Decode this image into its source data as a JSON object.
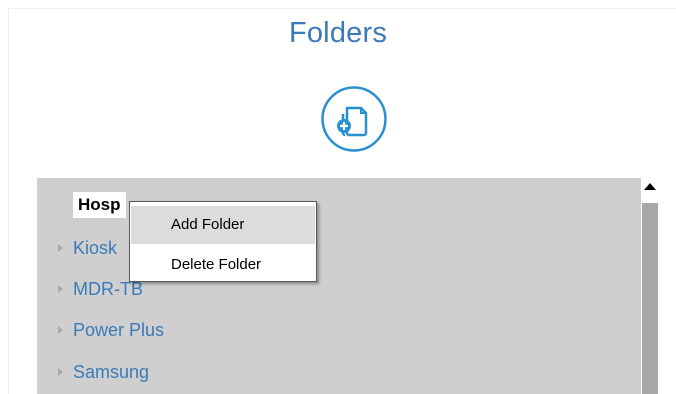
{
  "page": {
    "title": "Folders",
    "add_folder_icon": "folder-plus-icon"
  },
  "tree": {
    "root_label": "Hospital",
    "root_visible_text": "Hosp",
    "items": [
      {
        "label": "Kiosk",
        "icon": "collapsed-triangle-icon"
      },
      {
        "label": "MDR-TB",
        "icon": "collapsed-triangle-icon"
      },
      {
        "label": "Power Plus",
        "icon": "collapsed-triangle-icon"
      },
      {
        "label": "Samsung",
        "icon": "collapsed-triangle-icon"
      }
    ]
  },
  "context_menu": {
    "items": [
      {
        "label": "Add Folder",
        "highlighted": true
      },
      {
        "label": "Delete Folder",
        "highlighted": false
      }
    ]
  },
  "colors": {
    "accent": "#3a7ab8",
    "panel": "#cfcfcf",
    "menu_highlight": "#dcdcdc"
  }
}
